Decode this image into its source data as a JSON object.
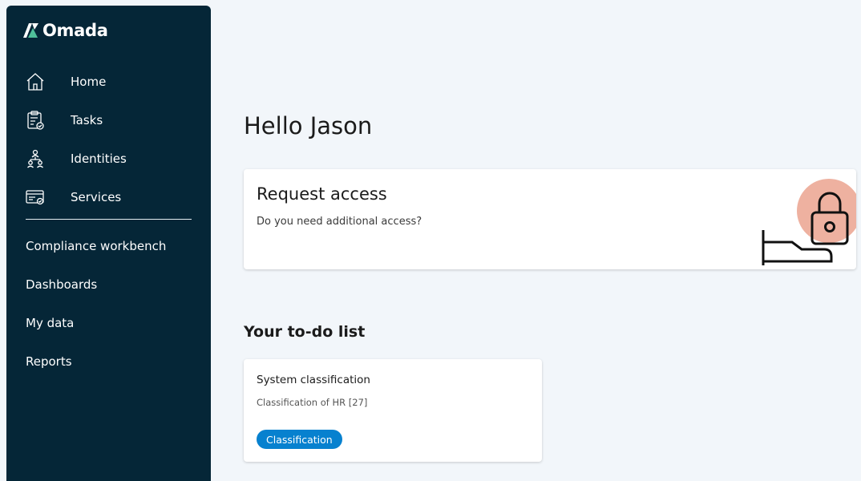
{
  "brand": {
    "name": "Omada"
  },
  "sidebar": {
    "primary": [
      {
        "label": "Home",
        "icon": "home-icon"
      },
      {
        "label": "Tasks",
        "icon": "clipboard-icon"
      },
      {
        "label": "Identities",
        "icon": "org-chart-icon"
      },
      {
        "label": "Services",
        "icon": "services-icon"
      }
    ],
    "secondary": [
      {
        "label": "Compliance workbench"
      },
      {
        "label": "Dashboards"
      },
      {
        "label": "My data"
      },
      {
        "label": "Reports"
      }
    ]
  },
  "main": {
    "greeting": "Hello Jason",
    "request_access": {
      "title": "Request access",
      "subtitle": "Do you need additional access?",
      "illustration": "lock-icon"
    },
    "todo": {
      "heading": "Your to-do list",
      "cards": [
        {
          "title": "System classification",
          "subtitle": "Classification of HR [27]",
          "badge": "Classification"
        }
      ]
    }
  },
  "colors": {
    "sidebar_bg": "#052637",
    "page_bg": "#f2f6fa",
    "accent": "#0781cf",
    "lock_circle": "#eeb1a0"
  }
}
